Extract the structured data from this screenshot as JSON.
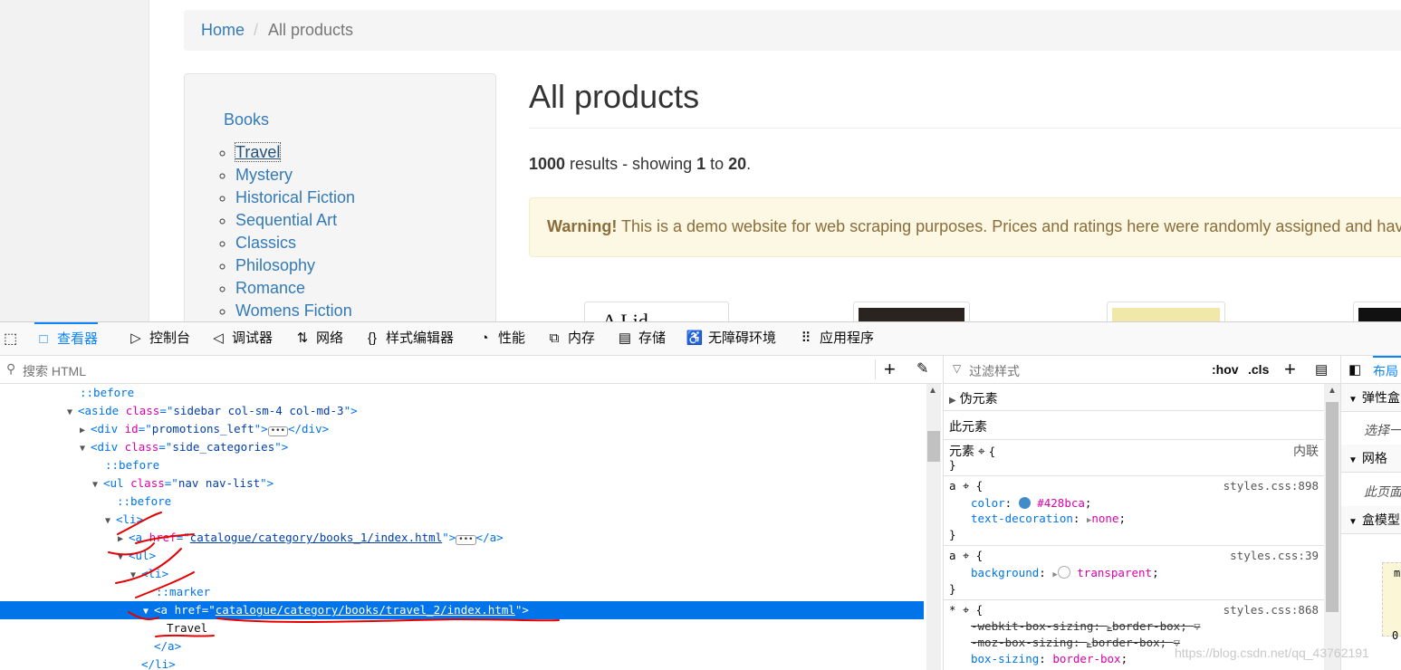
{
  "webpage": {
    "breadcrumb": {
      "home": "Home",
      "separator": "/",
      "current": "All products"
    },
    "sidebar": {
      "title": "Books",
      "categories": [
        "Travel",
        "Mystery",
        "Historical Fiction",
        "Sequential Art",
        "Classics",
        "Philosophy",
        "Romance",
        "Womens Fiction"
      ]
    },
    "title": "All products",
    "results": {
      "count": "1000",
      "text_mid": " results - showing ",
      "from": "1",
      "to_word": " to ",
      "to": "20",
      "end": "."
    },
    "warning": {
      "strong": "Warning!",
      "text": " This is a demo website for web scraping purposes. Prices and ratings here were randomly assigned and have n"
    },
    "thumb_text": "A Lid"
  },
  "devtools": {
    "tabs": [
      {
        "icon": "□",
        "label": "查看器"
      },
      {
        "icon": "▷",
        "label": "控制台"
      },
      {
        "icon": "◁",
        "label": "调试器"
      },
      {
        "icon": "⇅",
        "label": "网络"
      },
      {
        "icon": "{}",
        "label": "样式编辑器"
      },
      {
        "icon": "◔",
        "label": "性能"
      },
      {
        "icon": "⧉",
        "label": "内存"
      },
      {
        "icon": "▤",
        "label": "存储"
      },
      {
        "icon": "♿",
        "label": "无障碍环境"
      },
      {
        "icon": "⠿",
        "label": "应用程序"
      }
    ],
    "search_placeholder": "搜索 HTML",
    "markup": {
      "l1": "::before",
      "l2": {
        "tag": "aside",
        "attr": "class",
        "val": "sidebar col-sm-4 col-md-3"
      },
      "l3": {
        "tag": "div",
        "attr": "id",
        "val": "promotions_left",
        "close": "</div>"
      },
      "l4": {
        "tag": "div",
        "attr": "class",
        "val": "side_categories"
      },
      "l5": "::before",
      "l6": {
        "tag": "ul",
        "attr": "class",
        "val": "nav nav-list"
      },
      "l7": "::before",
      "l8": "<li>",
      "l9": {
        "tag": "a",
        "attr": "href",
        "val": "catalogue/category/books_1/index.html",
        "close": "</a>"
      },
      "l10": "<ul>",
      "l11": "<li>",
      "l12": "::marker",
      "l13": {
        "tag": "a",
        "attr": "href",
        "val": "catalogue/category/books/travel_2/index.html"
      },
      "l14": "Travel",
      "l15": "</a>",
      "l16": "</li>"
    },
    "rules": {
      "filter_placeholder": "过滤样式",
      "hov": ":hov",
      "cls": ".cls",
      "pseudo_elements": "伪元素",
      "this_element": "此元素",
      "element_label": "元素",
      "inline": "内联",
      "rule1": {
        "selector": "a",
        "source": "styles.css:898",
        "p1": "color",
        "v1": "#428bca",
        "p2": "text-decoration",
        "v2": "none",
        "color_swatch": "#428bca"
      },
      "rule2": {
        "selector": "a",
        "source": "styles.css:39",
        "p1": "background",
        "v1": "transparent"
      },
      "rule3": {
        "selector": "*",
        "source": "styles.css:868",
        "p1": "-webkit-box-sizing",
        "v1": "border-box",
        "p2": "-moz-box-sizing",
        "v2": "border-box",
        "p3": "box-sizing",
        "v3": "border-box"
      }
    },
    "layout": {
      "tab": "布局",
      "flexbox": "弹性盒",
      "flex_note": "选择一",
      "grid": "网格",
      "grid_note": "此页面",
      "boxmodel": "盒模型",
      "bm_m": "m",
      "bm_zero": "0"
    }
  },
  "watermark": "https://blog.csdn.net/qq_43762191"
}
